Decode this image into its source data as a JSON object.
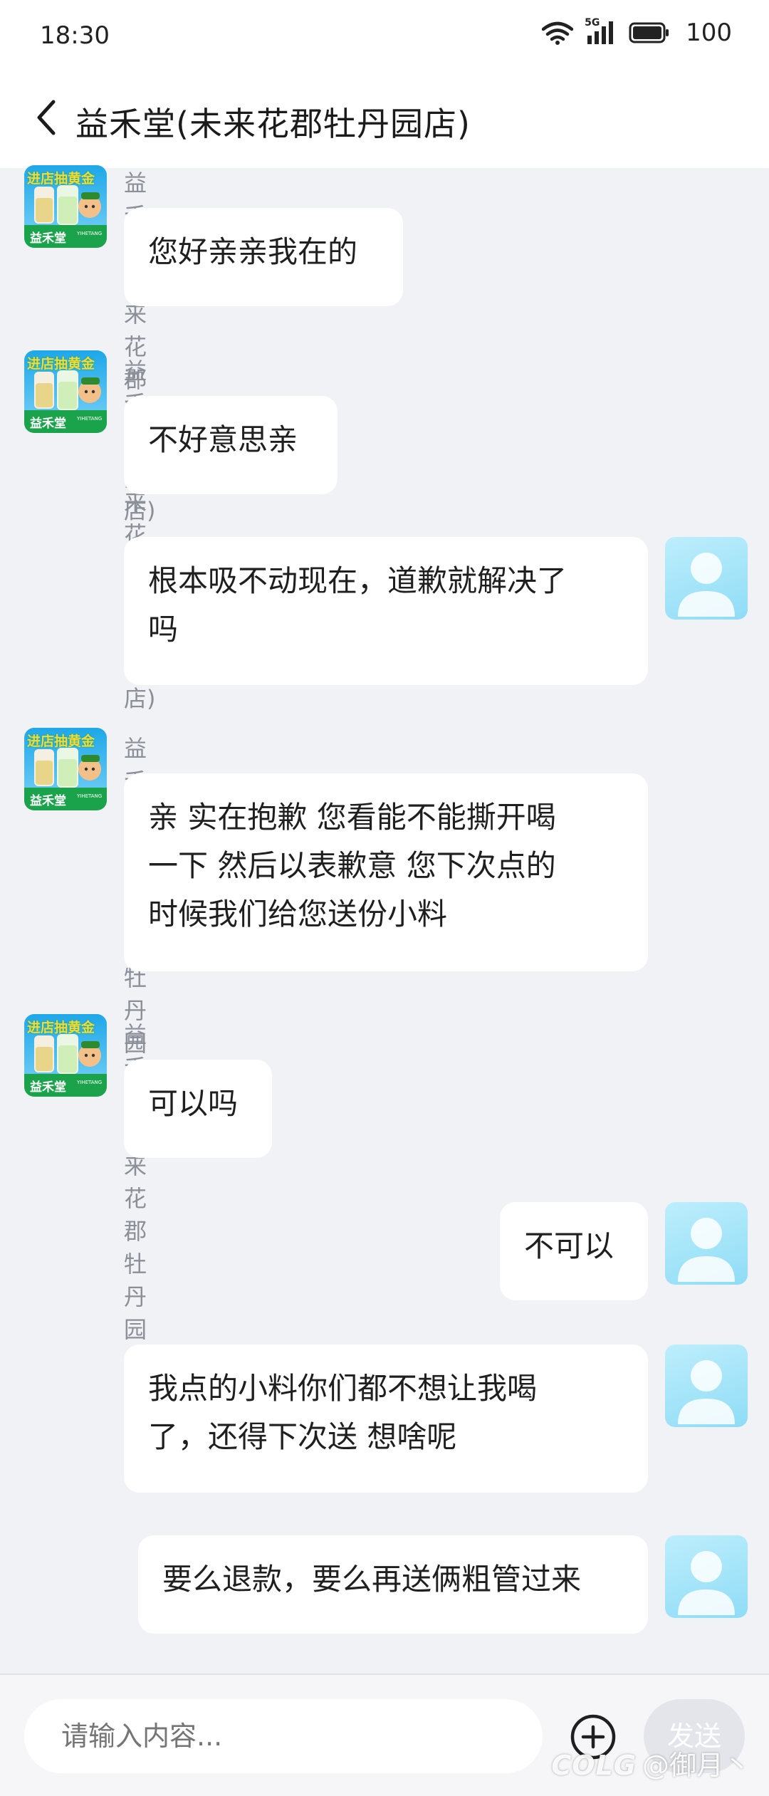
{
  "status_bar": {
    "time": "18:30",
    "network": "5G",
    "battery": "100"
  },
  "nav": {
    "title": "益禾堂(未来花郡牡丹园店)"
  },
  "messages": [
    {
      "from": "shop",
      "sender": "益禾堂(未来花郡牡丹园店)",
      "text": "您好亲亲我在的"
    },
    {
      "from": "shop",
      "sender": "益禾堂(未来花郡牡丹园店)",
      "text": "不好意思亲"
    },
    {
      "from": "user",
      "text": "根本吸不动现在，道歉就解决了\n吗"
    },
    {
      "from": "shop",
      "sender": "益禾堂(未来花郡牡丹园店)",
      "text": "亲 实在抱歉 您看能不能撕开喝\n一下 然后以表歉意 您下次点的\n时候我们给您送份小料"
    },
    {
      "from": "shop",
      "sender": "益禾堂(未来花郡牡丹园店)",
      "text": "可以吗"
    },
    {
      "from": "user",
      "text": "不可以"
    },
    {
      "from": "user",
      "text": "我点的小料你们都不想让我喝\n了，还得下次送 想啥呢"
    },
    {
      "from": "user",
      "text": "要么退款，要么再送俩粗管过来"
    }
  ],
  "shop_avatar": {
    "badge_text": "进店抽黄金",
    "brand_text": "益禾堂",
    "brand_sub": "YIHETANG"
  },
  "input": {
    "placeholder": "请输入内容...",
    "send_label": "发送"
  },
  "watermark": {
    "logo": "COLG",
    "handle": "@御月丶"
  },
  "colors": {
    "background": "#f1f2f6",
    "bubble": "#ffffff",
    "user_avatar": "#9fe2f8",
    "shop_avatar_top": "#1ea7e8",
    "shop_avatar_bottom": "#1aa34a",
    "badge": "#f7d93a"
  }
}
